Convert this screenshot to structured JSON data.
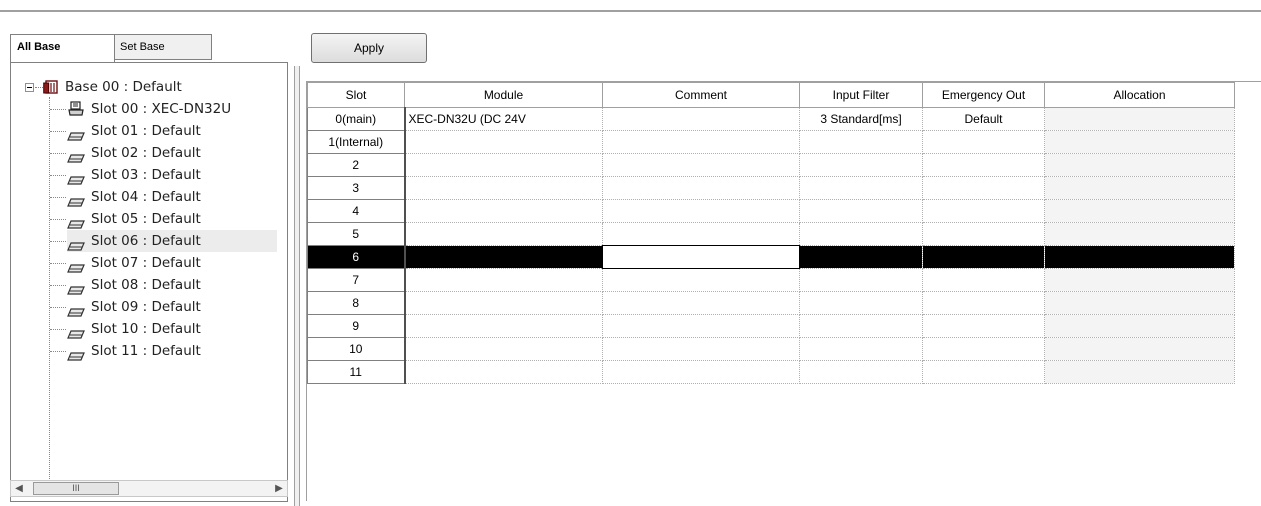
{
  "tabs": [
    {
      "label": "All Base",
      "active": true
    },
    {
      "label": "Set Base",
      "active": false
    }
  ],
  "tree": {
    "root": {
      "label": "Base 00 : Default",
      "icon": "base-icon"
    },
    "items": [
      {
        "label": "Slot 00 : XEC-DN32U",
        "icon": "cpu-module-icon"
      },
      {
        "label": "Slot 01 : Default",
        "icon": "slot-icon"
      },
      {
        "label": "Slot 02 : Default",
        "icon": "slot-icon"
      },
      {
        "label": "Slot 03 : Default",
        "icon": "slot-icon"
      },
      {
        "label": "Slot 04 : Default",
        "icon": "slot-icon"
      },
      {
        "label": "Slot 05 : Default",
        "icon": "slot-icon"
      },
      {
        "label": "Slot 06 : Default",
        "icon": "slot-icon",
        "selected": true
      },
      {
        "label": "Slot 07 : Default",
        "icon": "slot-icon"
      },
      {
        "label": "Slot 08 : Default",
        "icon": "slot-icon"
      },
      {
        "label": "Slot 09 : Default",
        "icon": "slot-icon"
      },
      {
        "label": "Slot 10 : Default",
        "icon": "slot-icon"
      },
      {
        "label": "Slot 11 : Default",
        "icon": "slot-icon"
      }
    ],
    "scroll_thumb_glyph": "III"
  },
  "toolbar": {
    "apply_label": "Apply"
  },
  "grid": {
    "columns": [
      "Slot",
      "Module",
      "Comment",
      "Input Filter",
      "Emergency Out",
      "Allocation"
    ],
    "rows": [
      {
        "slot": "0(main)",
        "module": "XEC-DN32U (DC 24V",
        "comment": "",
        "input_filter": "3 Standard[ms]",
        "emergency_out": "Default",
        "allocation": ""
      },
      {
        "slot": "1(Internal)",
        "module": "",
        "comment": "",
        "input_filter": "",
        "emergency_out": "",
        "allocation": ""
      },
      {
        "slot": "2",
        "module": "",
        "comment": "",
        "input_filter": "",
        "emergency_out": "",
        "allocation": ""
      },
      {
        "slot": "3",
        "module": "",
        "comment": "",
        "input_filter": "",
        "emergency_out": "",
        "allocation": ""
      },
      {
        "slot": "4",
        "module": "",
        "comment": "",
        "input_filter": "",
        "emergency_out": "",
        "allocation": ""
      },
      {
        "slot": "5",
        "module": "",
        "comment": "",
        "input_filter": "",
        "emergency_out": "",
        "allocation": ""
      },
      {
        "slot": "6",
        "module": "",
        "comment": "",
        "input_filter": "",
        "emergency_out": "",
        "allocation": "",
        "selected": true
      },
      {
        "slot": "7",
        "module": "",
        "comment": "",
        "input_filter": "",
        "emergency_out": "",
        "allocation": ""
      },
      {
        "slot": "8",
        "module": "",
        "comment": "",
        "input_filter": "",
        "emergency_out": "",
        "allocation": ""
      },
      {
        "slot": "9",
        "module": "",
        "comment": "",
        "input_filter": "",
        "emergency_out": "",
        "allocation": ""
      },
      {
        "slot": "10",
        "module": "",
        "comment": "",
        "input_filter": "",
        "emergency_out": "",
        "allocation": ""
      },
      {
        "slot": "11",
        "module": "",
        "comment": "",
        "input_filter": "",
        "emergency_out": "",
        "allocation": ""
      }
    ]
  },
  "colors": {
    "selected_row": "#000000",
    "grid_line": "#a0a0a0",
    "allocation_bg": "#f4f4f4"
  }
}
